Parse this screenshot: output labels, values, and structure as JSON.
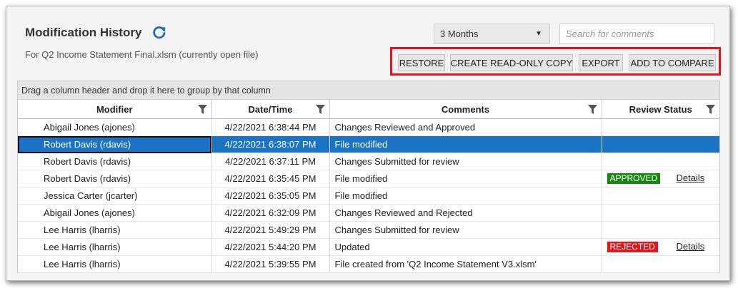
{
  "header": {
    "title": "Modification History",
    "subtitle": "For Q2 Income Statement Final.xlsm (currently open file)"
  },
  "period_select": {
    "value": "3 Months"
  },
  "search": {
    "placeholder": "Search for comments"
  },
  "toolbar": {
    "restore_label": "RESTORE",
    "readonly_copy_label": "CREATE READ-ONLY COPY",
    "export_label": "EXPORT",
    "compare_label": "ADD TO COMPARE"
  },
  "grid": {
    "group_hint": "Drag a column header and drop it here to group by that column",
    "columns": [
      "Modifier",
      "Date/Time",
      "Comments",
      "Review Status"
    ],
    "rows": [
      {
        "modifier": "Abigail Jones (ajones)",
        "datetime": "4/22/2021 6:38:44 PM",
        "comment": "Changes Reviewed and Approved",
        "status": "",
        "details": ""
      },
      {
        "modifier": "Robert Davis (rdavis)",
        "datetime": "4/22/2021 6:38:07 PM",
        "comment": "File modified",
        "status": "",
        "details": ""
      },
      {
        "modifier": "Robert Davis (rdavis)",
        "datetime": "4/22/2021 6:37:11 PM",
        "comment": "Changes Submitted for review",
        "status": "",
        "details": ""
      },
      {
        "modifier": "Robert Davis (rdavis)",
        "datetime": "4/22/2021 6:35:45 PM",
        "comment": "File modified",
        "status": "APPROVED",
        "details": "Details"
      },
      {
        "modifier": "Jessica  Carter (jcarter)",
        "datetime": "4/22/2021 6:35:05 PM",
        "comment": "File modified",
        "status": "",
        "details": ""
      },
      {
        "modifier": "Abigail Jones (ajones)",
        "datetime": "4/22/2021 6:32:09 PM",
        "comment": "Changes Reviewed and Rejected",
        "status": "",
        "details": ""
      },
      {
        "modifier": "Lee Harris (lharris)",
        "datetime": "4/22/2021 5:49:29 PM",
        "comment": "Changes Submitted for review",
        "status": "",
        "details": ""
      },
      {
        "modifier": "Lee Harris (lharris)",
        "datetime": "4/22/2021 5:44:20 PM",
        "comment": "Updated",
        "status": "REJECTED",
        "details": "Details"
      },
      {
        "modifier": "Lee Harris (lharris)",
        "datetime": "4/22/2021 5:39:55 PM",
        "comment": "File created from 'Q2 Income Statement V3.xlsm'",
        "status": "",
        "details": ""
      }
    ]
  },
  "colors": {
    "selection": "#1a73c5",
    "approved": "#15890f",
    "rejected": "#e8141b",
    "highlight_border": "#e8141b",
    "refresh_icon": "#1b6ec2"
  },
  "icons": [
    "refresh-icon",
    "dropdown-caret-icon",
    "filter-icon"
  ]
}
